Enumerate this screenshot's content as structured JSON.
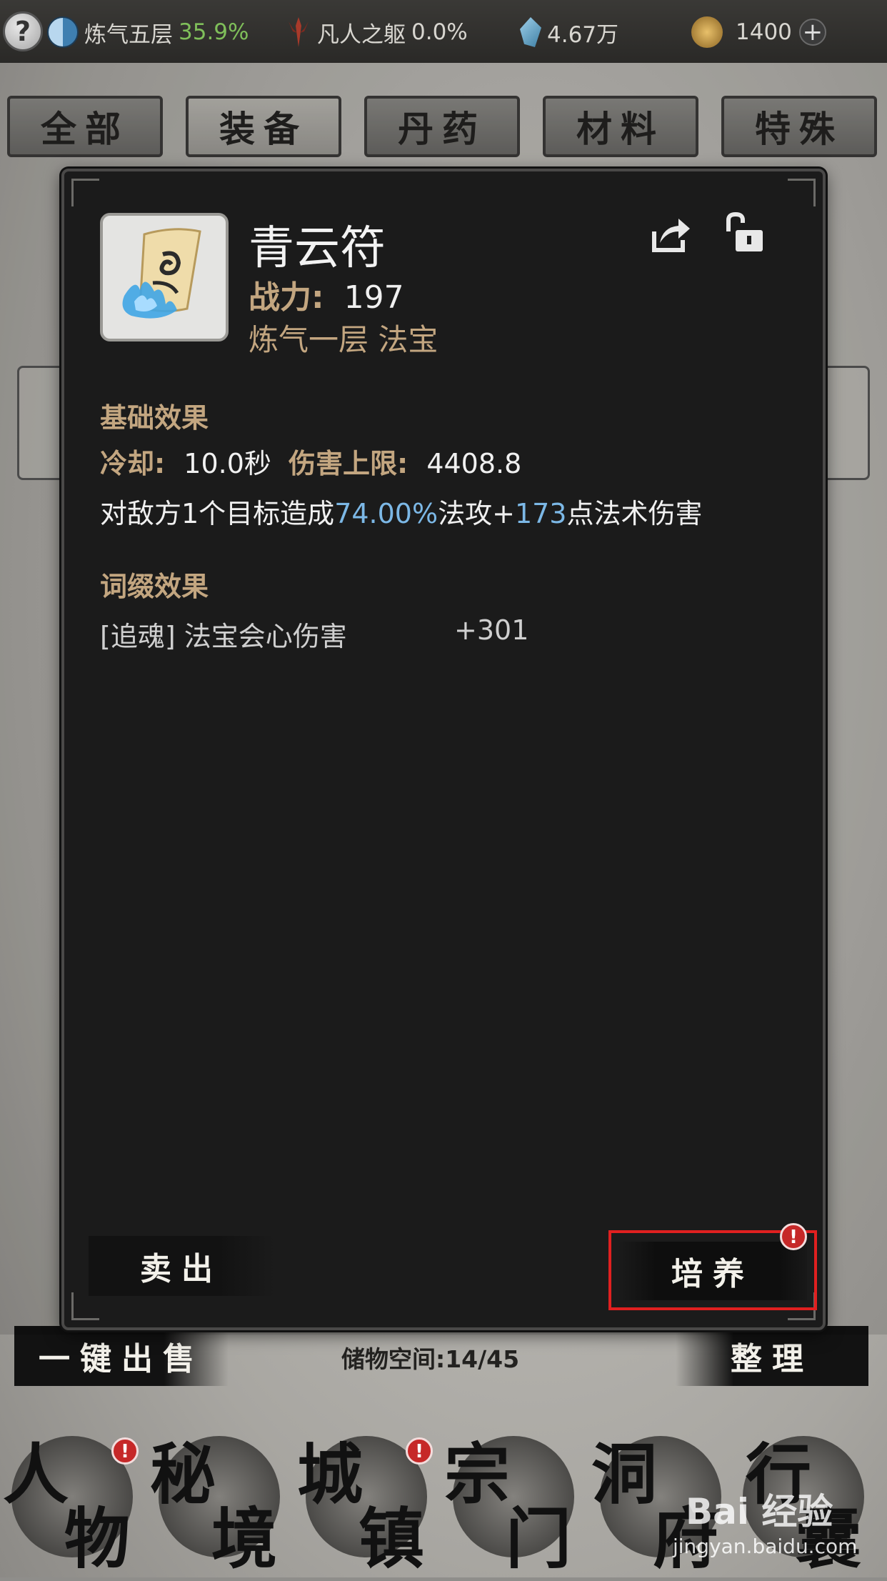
{
  "topbar": {
    "realm_label": "炼气五层",
    "realm_progress": "35.9%",
    "body_label": "凡人之躯",
    "body_progress": "0.0%",
    "spirit_stone": "4.67万",
    "currency": "1400",
    "help_glyph": "?",
    "plus_glyph": "+"
  },
  "tabs": [
    {
      "label": "全部",
      "active": false
    },
    {
      "label": "装备",
      "active": true
    },
    {
      "label": "丹药",
      "active": false
    },
    {
      "label": "材料",
      "active": false
    },
    {
      "label": "特殊",
      "active": false
    }
  ],
  "item": {
    "name": "青云符",
    "power_label": "战力:",
    "power_value": "197",
    "subtype": "炼气一层  法宝",
    "icon": "talisman-scroll-icon"
  },
  "basic": {
    "title": "基础效果",
    "cooldown_label": "冷却:",
    "cooldown_value": "10.0秒",
    "cap_label": "伤害上限:",
    "cap_value": "4408.8",
    "desc_prefix": "对敌方1个目标造成",
    "desc_pct": "74.00%",
    "desc_mid": "法攻+",
    "desc_num": "173",
    "desc_suffix": "点法术伤害"
  },
  "affix": {
    "title": "词缀效果",
    "name": "[追魂] 法宝会心伤害",
    "value": "+301"
  },
  "actions": {
    "sell": "卖出",
    "train": "培养",
    "alert": "!"
  },
  "bottom": {
    "quick_sell": "一键出售",
    "storage": "储物空间:14/45",
    "sort": "整理"
  },
  "nav": [
    {
      "c1": "人",
      "c2": "物",
      "badge": true
    },
    {
      "c1": "秘",
      "c2": "境",
      "badge": false
    },
    {
      "c1": "城",
      "c2": "镇",
      "badge": true
    },
    {
      "c1": "宗",
      "c2": "门",
      "badge": false
    },
    {
      "c1": "洞",
      "c2": "府",
      "badge": false
    },
    {
      "c1": "行",
      "c2": "囊",
      "badge": false
    }
  ],
  "watermark": {
    "logo": "Bai 经验",
    "url": "jingyan.baidu.com"
  },
  "colors": {
    "accent_gold": "#c3a680",
    "highlight_blue": "#7cb8e6",
    "progress_green": "#7fbf5a",
    "alert_red": "#c62828",
    "selection_outline": "#e02020"
  }
}
